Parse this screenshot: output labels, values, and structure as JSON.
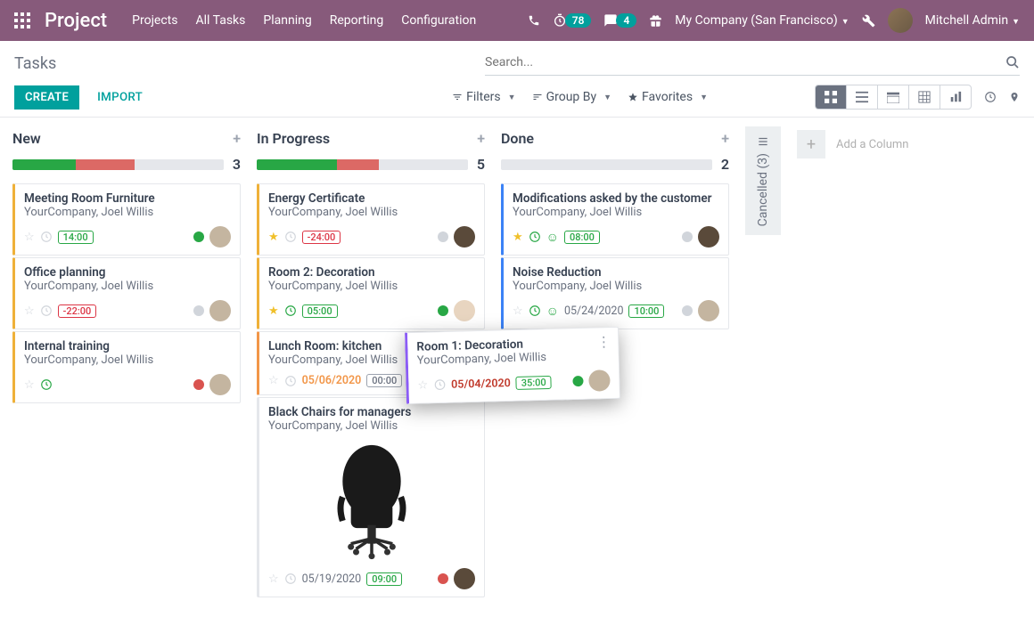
{
  "header": {
    "brand": "Project",
    "nav": [
      "Projects",
      "All Tasks",
      "Planning",
      "Reporting",
      "Configuration"
    ],
    "clock_badge": "78",
    "messages_badge": "4",
    "company": "My Company (San Francisco)",
    "user": "Mitchell Admin"
  },
  "control": {
    "breadcrumb": "Tasks",
    "search_placeholder": "Search...",
    "create": "CREATE",
    "import": "IMPORT",
    "filters": "Filters",
    "groupby": "Group By",
    "favorites": "Favorites"
  },
  "columns": {
    "new": {
      "title": "New",
      "count": "3"
    },
    "in_progress": {
      "title": "In Progress",
      "count": "5"
    },
    "done": {
      "title": "Done",
      "count": "2"
    },
    "cancelled": "Cancelled (3)"
  },
  "add_column": "Add a Column",
  "cards": {
    "new": [
      {
        "title": "Meeting Room Furniture",
        "sub": "YourCompany, Joel Willis",
        "time": "14:00",
        "time_style": "green",
        "dot": "green"
      },
      {
        "title": "Office planning",
        "sub": "YourCompany, Joel Willis",
        "time": "-22:00",
        "time_style": "red",
        "dot": "gray"
      },
      {
        "title": "Internal training",
        "sub": "YourCompany, Joel Willis",
        "dot": "red",
        "clock": "green"
      }
    ],
    "in_progress": [
      {
        "title": "Energy Certificate",
        "sub": "YourCompany, Joel Willis",
        "time": "-24:00",
        "time_style": "red",
        "star": true,
        "dot": "gray"
      },
      {
        "title": "Room 2: Decoration",
        "sub": "YourCompany, Joel Willis",
        "time": "05:00",
        "time_style": "green",
        "star": true,
        "clock": "green",
        "dot": "green"
      },
      {
        "title": "Lunch Room: kitchen",
        "sub": "YourCompany, Joel Willis",
        "date": "05/06/2020",
        "date_style": "orange",
        "time": "00:00",
        "time_style": "gray"
      },
      {
        "title": "Black Chairs for managers",
        "sub": "YourCompany, Joel Willis",
        "date": "05/19/2020",
        "date_style": "gray",
        "time": "09:00",
        "time_style": "green",
        "dot": "red",
        "has_image": true
      }
    ],
    "done": [
      {
        "title": "Modifications asked by the customer",
        "sub": "YourCompany, Joel Willis",
        "time": "08:00",
        "time_style": "green",
        "star": true,
        "clock": "green",
        "smiley": true,
        "dot": "gray"
      },
      {
        "title": "Noise Reduction",
        "sub": "YourCompany, Joel Willis",
        "date": "05/24/2020",
        "date_style": "gray",
        "time": "10:00",
        "time_style": "green",
        "clock": "green",
        "smiley": true,
        "dot": "gray"
      }
    ],
    "dragging": {
      "title": "Room 1: Decoration",
      "sub": "YourCompany, Joel Willis",
      "date": "05/04/2020",
      "date_style": "red",
      "time": "35:00",
      "time_style": "green",
      "dot": "green"
    }
  }
}
